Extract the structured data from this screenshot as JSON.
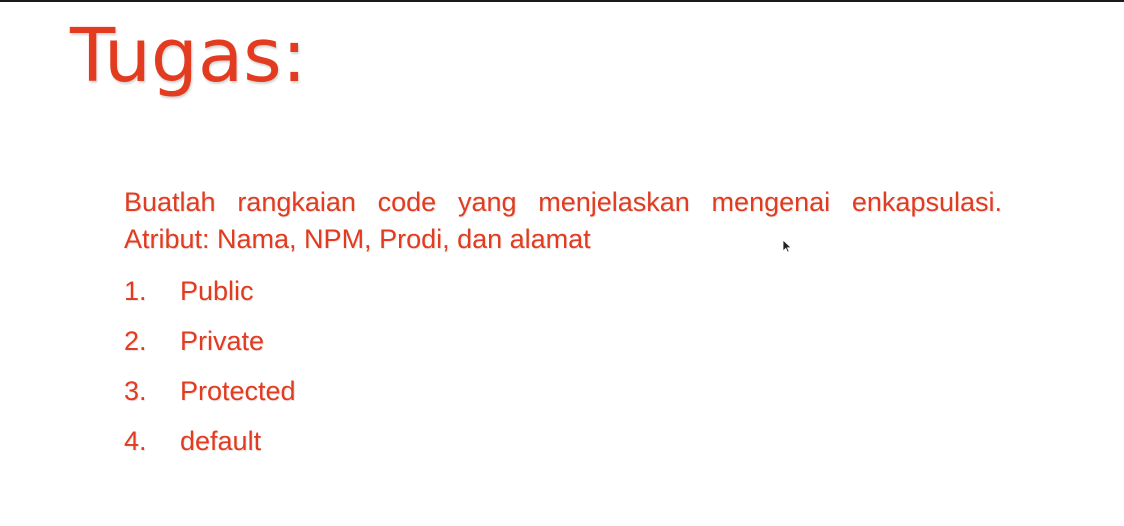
{
  "slide": {
    "title": "Tugas:",
    "paragraph": "Buatlah rangkaian code yang menjelaskan mengenai enkapsulasi. Atribut: Nama, NPM, Prodi, dan alamat",
    "items": [
      {
        "number": "1.",
        "label": "Public"
      },
      {
        "number": "2.",
        "label": "Private"
      },
      {
        "number": "3.",
        "label": "Protected"
      },
      {
        "number": "4.",
        "label": "default"
      }
    ]
  },
  "colors": {
    "text_accent": "#e23b1f",
    "background": "#ffffff"
  },
  "icons": {
    "cursor": "mouse-pointer-icon"
  }
}
